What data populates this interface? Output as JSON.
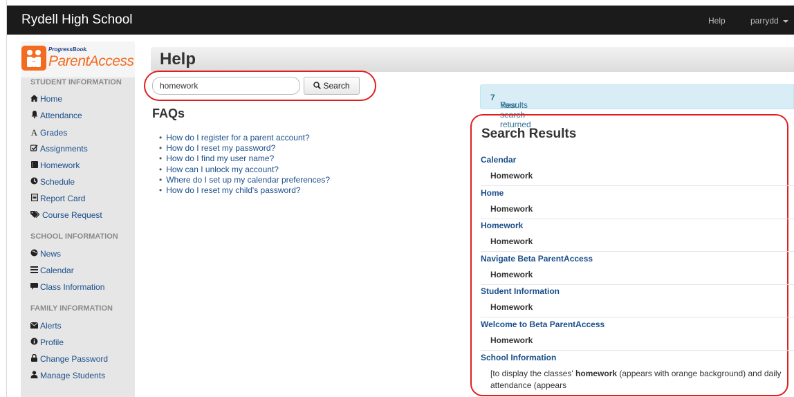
{
  "navbar": {
    "school_name": "Rydell High School",
    "help_label": "Help",
    "username": "parrydd"
  },
  "logo": {
    "small_text": "ProgressBook.",
    "big_text": "ParentAccess"
  },
  "sidebar": {
    "sections": [
      {
        "title": "STUDENT INFORMATION",
        "items": [
          {
            "label": "Home",
            "icon": "home-icon"
          },
          {
            "label": "Attendance",
            "icon": "bell-icon"
          },
          {
            "label": "Grades",
            "icon": "font-a-icon"
          },
          {
            "label": "Assignments",
            "icon": "check-square-icon"
          },
          {
            "label": "Homework",
            "icon": "book-icon"
          },
          {
            "label": "Schedule",
            "icon": "clock-icon"
          },
          {
            "label": "Report Card",
            "icon": "report-icon"
          },
          {
            "label": "Course Request",
            "icon": "tags-icon"
          }
        ]
      },
      {
        "title": "SCHOOL INFORMATION",
        "items": [
          {
            "label": "News",
            "icon": "globe-icon"
          },
          {
            "label": "Calendar",
            "icon": "list-icon"
          },
          {
            "label": "Class Information",
            "icon": "comment-icon"
          }
        ]
      },
      {
        "title": "FAMILY INFORMATION",
        "items": [
          {
            "label": "Alerts",
            "icon": "envelope-icon"
          },
          {
            "label": "Profile",
            "icon": "info-icon"
          },
          {
            "label": "Change Password",
            "icon": "lock-icon"
          },
          {
            "label": "Manage Students",
            "icon": "user-icon"
          }
        ]
      }
    ]
  },
  "page": {
    "title": "Help"
  },
  "search": {
    "value": "homework",
    "button_label": "Search"
  },
  "faq": {
    "title": "FAQs",
    "items": [
      "How do I register for a parent account?",
      "How do I reset my password?",
      "How do I find my user name?",
      "How can I unlock my account?",
      "Where do I set up my calendar preferences?",
      "How do I reset my child's password?"
    ]
  },
  "results": {
    "banner_prefix": "Your search returned",
    "count": "7",
    "banner_suffix": "Results",
    "title": "Search Results",
    "items": [
      {
        "title": "Calendar",
        "subtitle": "Homework"
      },
      {
        "title": "Home",
        "subtitle": "Homework"
      },
      {
        "title": "Homework",
        "subtitle": "Homework"
      },
      {
        "title": "Navigate Beta ParentAccess",
        "subtitle": "Homework"
      },
      {
        "title": "Student Information",
        "subtitle": "Homework"
      },
      {
        "title": "Welcome to Beta ParentAccess",
        "subtitle": "Homework"
      },
      {
        "title": "School Information"
      }
    ],
    "snippet": {
      "before": "[to display the classes' ",
      "highlight": "homework",
      "after": " (appears with orange background) and daily attendance (appears"
    }
  },
  "colors": {
    "navbar_bg": "#1b1b1b",
    "link": "#1a4e8a",
    "brand_orange": "#f26b21",
    "annotation_red": "#e01f1f",
    "banner_bg": "#d9edf7"
  }
}
